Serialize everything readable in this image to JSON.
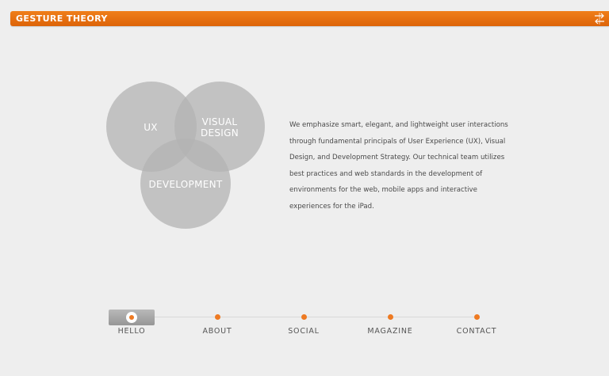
{
  "app": {
    "title": "GESTURE THEORY"
  },
  "venn": {
    "circles": [
      "UX",
      "VISUAL",
      "DESIGN",
      "DEVELOPMENT"
    ]
  },
  "description": "We emphasize smart, elegant, and lightweight user interactions through fundamental principals of User Experience (UX), Visual Design, and Development Strategy. Our technical team utilizes best practices and web standards in the development of environments for the web, mobile apps and interactive experiences for the iPad.",
  "nav": {
    "items": [
      {
        "label": "HELLO"
      },
      {
        "label": "ABOUT"
      },
      {
        "label": "SOCIAL"
      },
      {
        "label": "MAGAZINE"
      },
      {
        "label": "CONTACT"
      }
    ],
    "active": "HELLO"
  },
  "colors": {
    "accent": "#ee7a22",
    "circle": "#b3b3b3"
  },
  "icons": [
    "menu-arrows-icon"
  ]
}
